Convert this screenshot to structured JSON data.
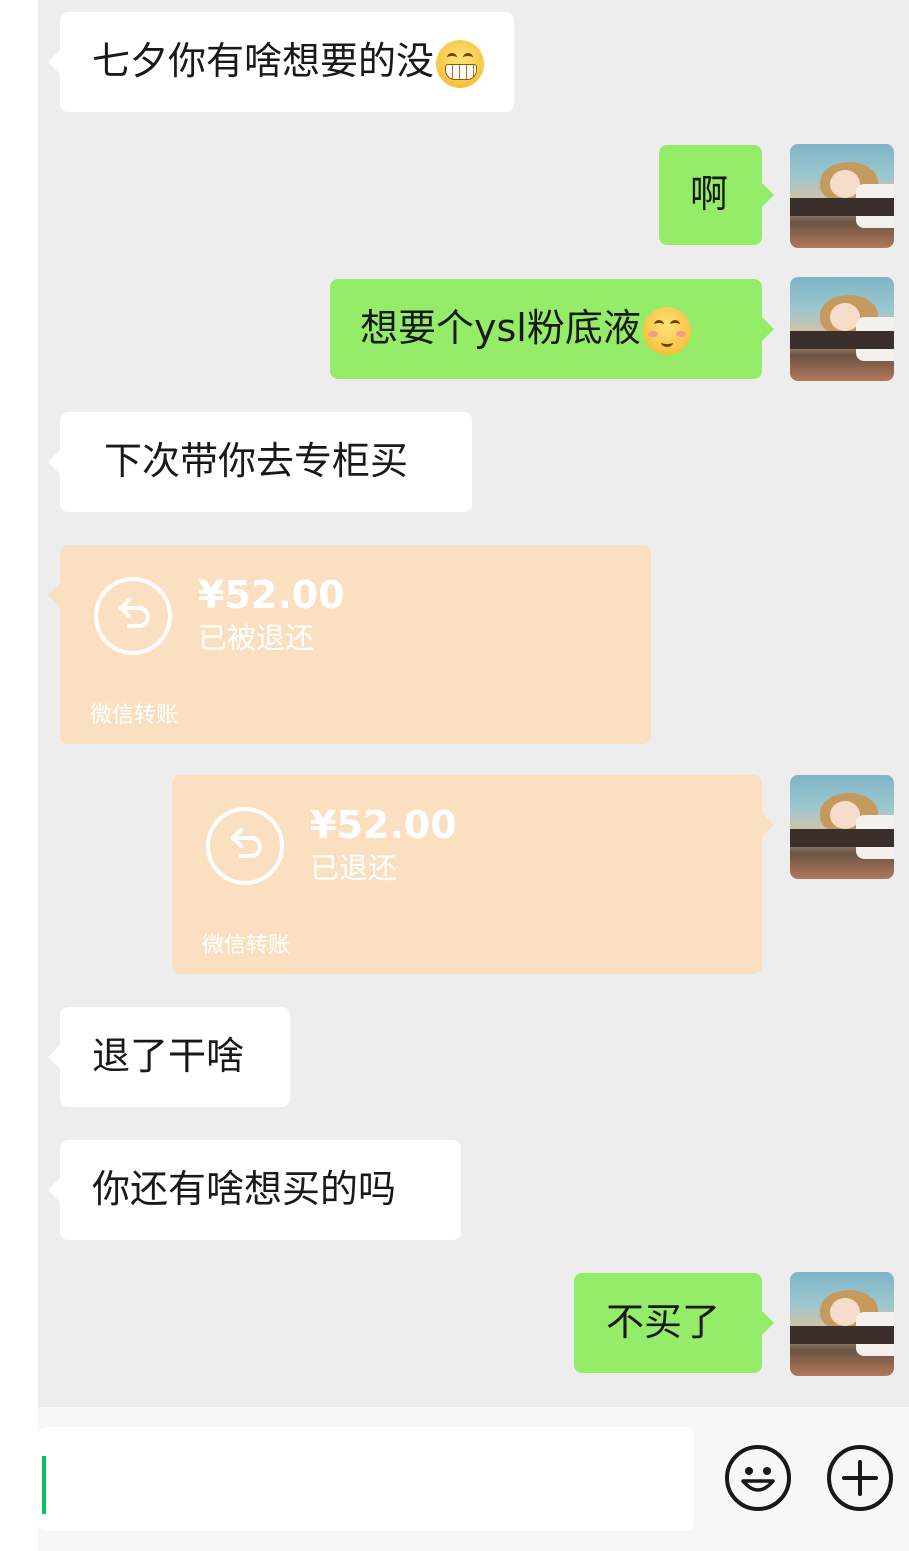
{
  "messages": [
    {
      "side": "in",
      "text": "七夕你有啥想要的没",
      "emoji": "grin-icon"
    },
    {
      "side": "out",
      "text": "啊"
    },
    {
      "side": "out",
      "text": "想要个ysl粉底液",
      "emoji": "blush-icon"
    },
    {
      "side": "in",
      "text": "下次带你去专柜买"
    },
    {
      "side": "in",
      "type": "transfer",
      "amount": "¥52.00",
      "status": "已被退还",
      "source": "微信转账"
    },
    {
      "side": "out",
      "type": "transfer",
      "amount": "¥52.00",
      "status": "已退还",
      "source": "微信转账"
    },
    {
      "side": "in",
      "text": "退了干啥"
    },
    {
      "side": "in",
      "text": "你还有啥想买的吗"
    },
    {
      "side": "out",
      "text": "不买了"
    }
  ],
  "colors": {
    "chat_background": "#ededed",
    "incoming_bubble": "#ffffff",
    "outgoing_bubble": "#95ec69",
    "transfer_card": "#fae0c1",
    "caret": "#07c160"
  },
  "input_bar": {
    "input_value": "",
    "emoji_button_icon": "smiley-icon",
    "more_button_icon": "plus-icon"
  }
}
